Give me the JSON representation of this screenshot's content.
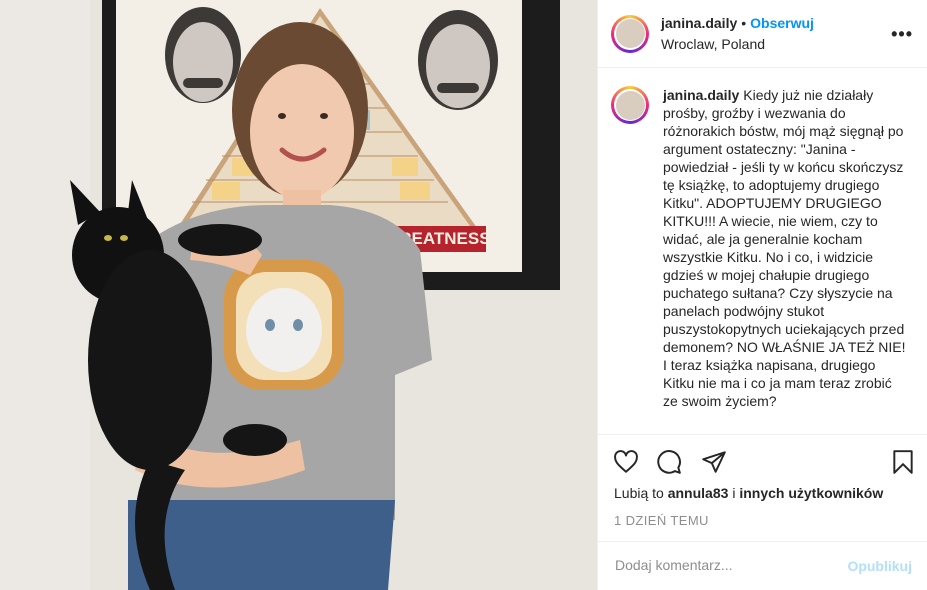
{
  "post": {
    "username": "janina.daily",
    "separator": "•",
    "follow_label": "Obserwuj",
    "location": "Wroclaw, Poland",
    "more_label": "•••",
    "caption": "Kiedy już nie działały prośby, groźby i wezwania do różnorakich bóstw, mój mąż sięgnął po argument ostateczny: \"Janina - powiedział - jeśli ty w końcu skończysz tę książkę, to adoptujemy drugiego Kitku\". ADOPTUJEMY DRUGIEGO KITKU!!! A wiecie, nie wiem, czy to widać, ale ja generalnie kocham wszystkie Kitku. No i co, i widzicie gdzieś w mojej chałupie drugiego puchatego sułtana? Czy słyszycie na panelach podwójny stukot puszystokopytnych uciekających przed demonem? NO WŁAŚNIE JA TEŻ NIE! I teraz książka napisana, drugiego Kitku nie ma i co ja mam teraz zrobić ze swoim życiem?",
    "likes": {
      "prefix": "Lubią to",
      "user": "annula83",
      "connector": "i",
      "others": "innych użytkowników"
    },
    "time_ago": "1 DZIEŃ TEMU",
    "comment": {
      "placeholder": "Dodaj komentarz...",
      "value": "",
      "publish_label": "Opublikuj"
    },
    "poster_text": "GREATNESS",
    "colors": {
      "link_blue": "#0095f6",
      "publish_disabled": "#b2dffc",
      "muted": "#8e8e8e",
      "text": "#262626"
    }
  }
}
